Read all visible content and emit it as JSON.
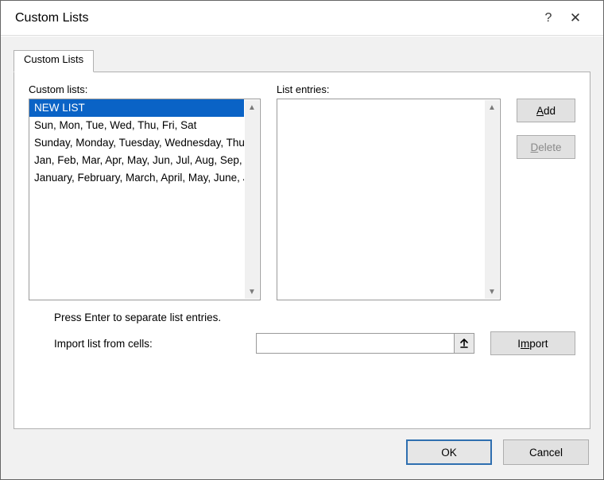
{
  "window": {
    "title": "Custom Lists"
  },
  "tabs": [
    {
      "label": "Custom Lists"
    }
  ],
  "labels": {
    "custom_lists": "Custom lists:",
    "list_entries": "List entries:",
    "hint": "Press Enter to separate list entries.",
    "import_from_cells": "Import list from cells:"
  },
  "custom_lists": [
    {
      "text": "NEW LIST",
      "selected": true
    },
    {
      "text": "Sun, Mon, Tue, Wed, Thu, Fri, Sat",
      "selected": false
    },
    {
      "text": "Sunday, Monday, Tuesday, Wednesday, Thursday, Friday, Saturday",
      "selected": false
    },
    {
      "text": "Jan, Feb, Mar, Apr, May, Jun, Jul, Aug, Sep, Oct, Nov, Dec",
      "selected": false
    },
    {
      "text": "January, February, March, April, May, June, July, August, September, October, November, December",
      "selected": false
    }
  ],
  "list_entries_value": "",
  "import_cells_value": "",
  "buttons": {
    "add": "Add",
    "delete": "Delete",
    "import": "Import",
    "ok": "OK",
    "cancel": "Cancel"
  },
  "underline": {
    "add_first": "A",
    "add_rest": "dd",
    "delete_first": "D",
    "delete_rest": "elete",
    "import_first": "I",
    "import_rest": "mport",
    "custom_lists_pre": "Custom ",
    "custom_lists_u": "l",
    "custom_lists_post": "ists:",
    "list_entries_pre": "List ",
    "list_entries_u": "e",
    "list_entries_post": "ntries:",
    "import_label_u": "I",
    "import_label_rest": "mport list from cells:",
    "import_btn_pre": "I",
    "import_btn_u": "m",
    "import_btn_post": "port"
  }
}
